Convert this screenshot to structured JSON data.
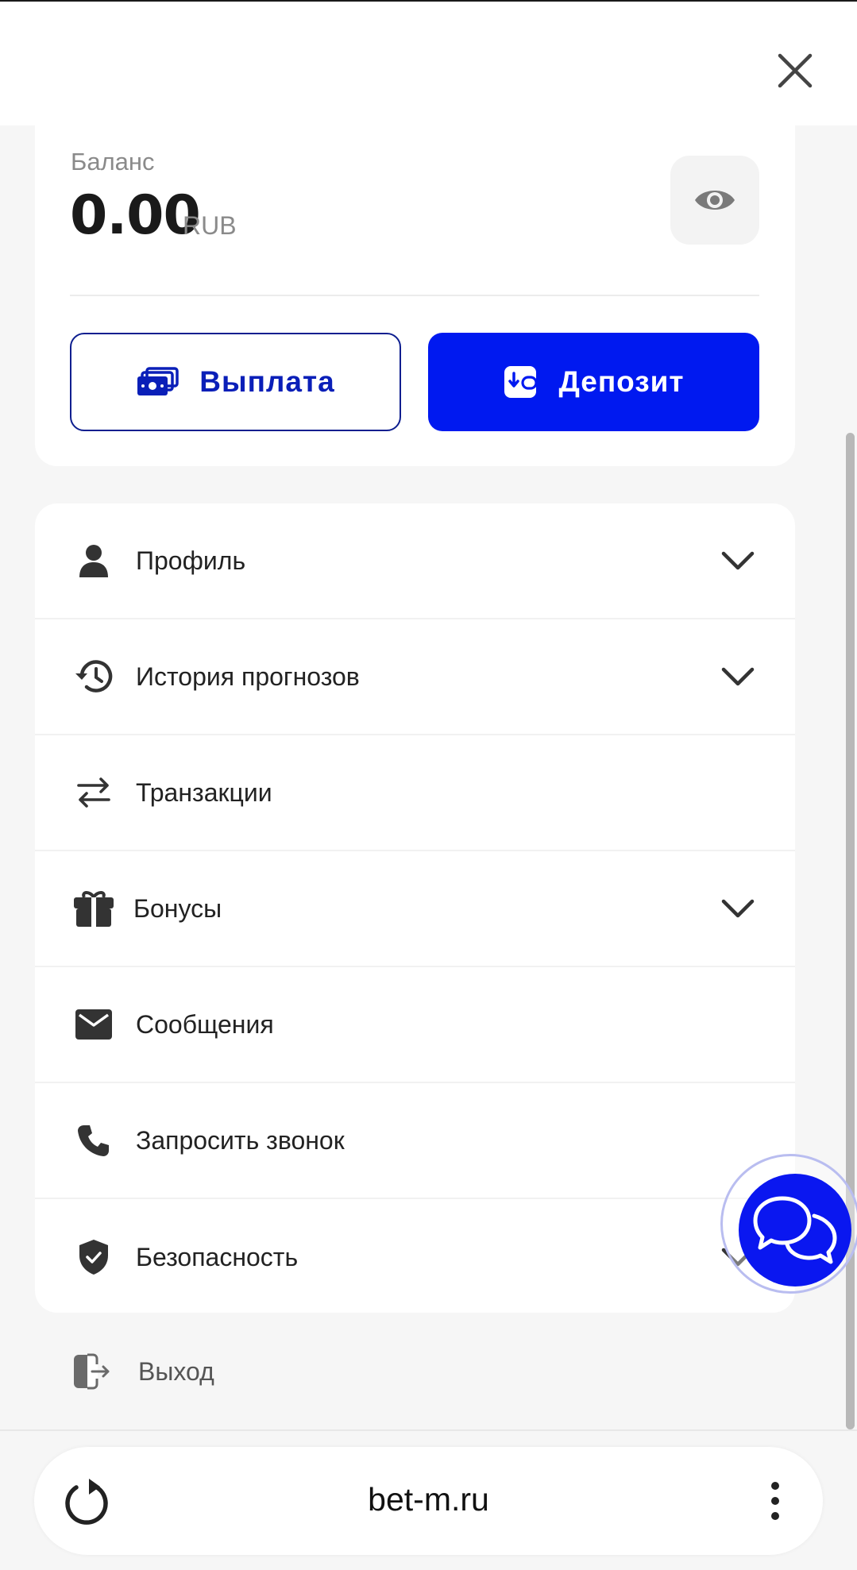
{
  "balance": {
    "label": "Баланс",
    "amount": "0.00",
    "currency": "RUB",
    "toggle_icon": "eye-icon"
  },
  "actions": {
    "payout_label": "Выплата",
    "payout_icon": "cash-stack-icon",
    "deposit_label": "Депозит",
    "deposit_icon": "wallet-in-icon"
  },
  "menu": {
    "items": [
      {
        "label": "Профиль",
        "icon": "user-icon",
        "expandable": true
      },
      {
        "label": "История прогнозов",
        "icon": "history-icon",
        "expandable": true
      },
      {
        "label": "Транзакции",
        "icon": "transfer-arrows-icon",
        "expandable": false
      },
      {
        "label": "Бонусы",
        "icon": "gift-icon",
        "expandable": true
      },
      {
        "label": "Сообщения",
        "icon": "envelope-icon",
        "expandable": false
      },
      {
        "label": "Запросить звонок",
        "icon": "phone-icon",
        "expandable": false
      },
      {
        "label": "Безопасность",
        "icon": "shield-check-icon",
        "expandable": true
      }
    ]
  },
  "logout": {
    "label": "Выход",
    "icon": "logout-icon"
  },
  "browser": {
    "url": "bet-m.ru"
  },
  "colors": {
    "accent": "#0019f0",
    "payout_border": "#0d1e8f",
    "page_bg": "#f6f6f6"
  }
}
